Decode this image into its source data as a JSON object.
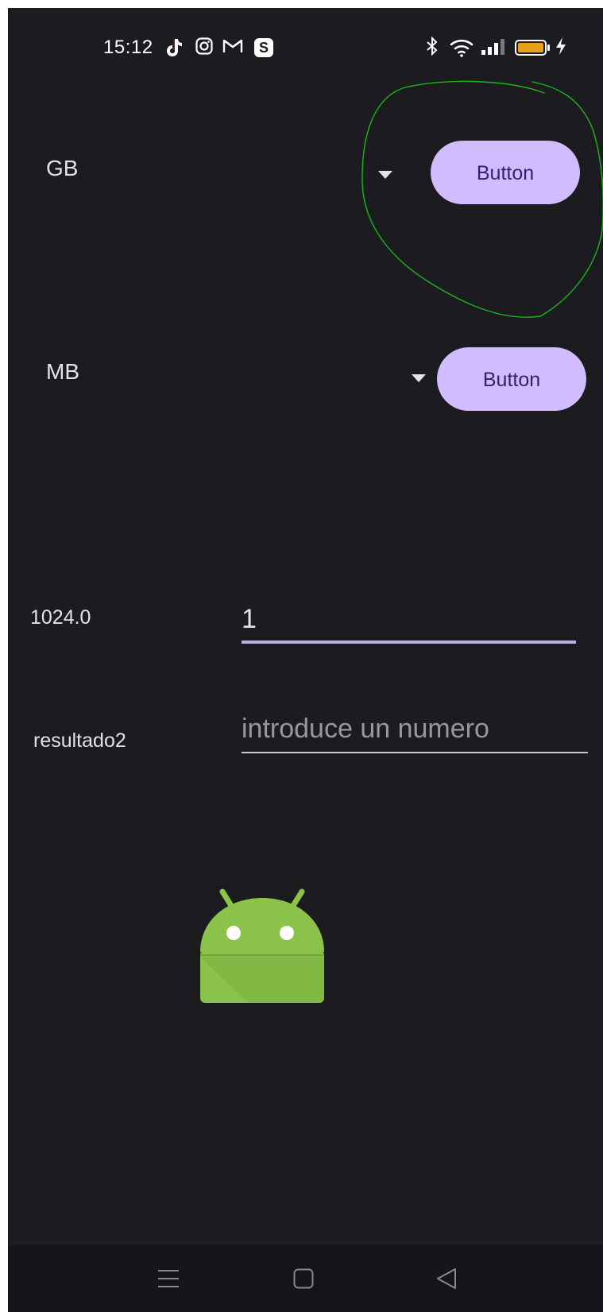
{
  "status_bar": {
    "time": "15:12",
    "icons": [
      "tiktok-icon",
      "instagram-icon",
      "gmail-icon",
      "s-app-icon",
      "bluetooth-icon",
      "wifi-icon",
      "signal-icon",
      "battery-icon",
      "charging-icon"
    ],
    "s_app_letter": "S",
    "battery_color": "#e6a21b"
  },
  "unit_rows": [
    {
      "selected_unit": "GB",
      "button_label": "Button"
    },
    {
      "selected_unit": "MB",
      "button_label": "Button"
    }
  ],
  "fields": {
    "result1_label": "1024.0",
    "input1_value": "1",
    "result2_label": "resultado2",
    "input2_placeholder": "introduce un numero"
  },
  "image": {
    "icon": "android-robot-icon"
  },
  "annotation": {
    "color": "#1bb51b"
  },
  "nav_bar": {
    "icons": [
      "menu-icon",
      "home-icon",
      "back-icon"
    ]
  },
  "colors": {
    "background": "#1c1b1f",
    "button_fill": "#d0bcff",
    "button_text": "#381e72",
    "text": "#e6e1e5"
  }
}
